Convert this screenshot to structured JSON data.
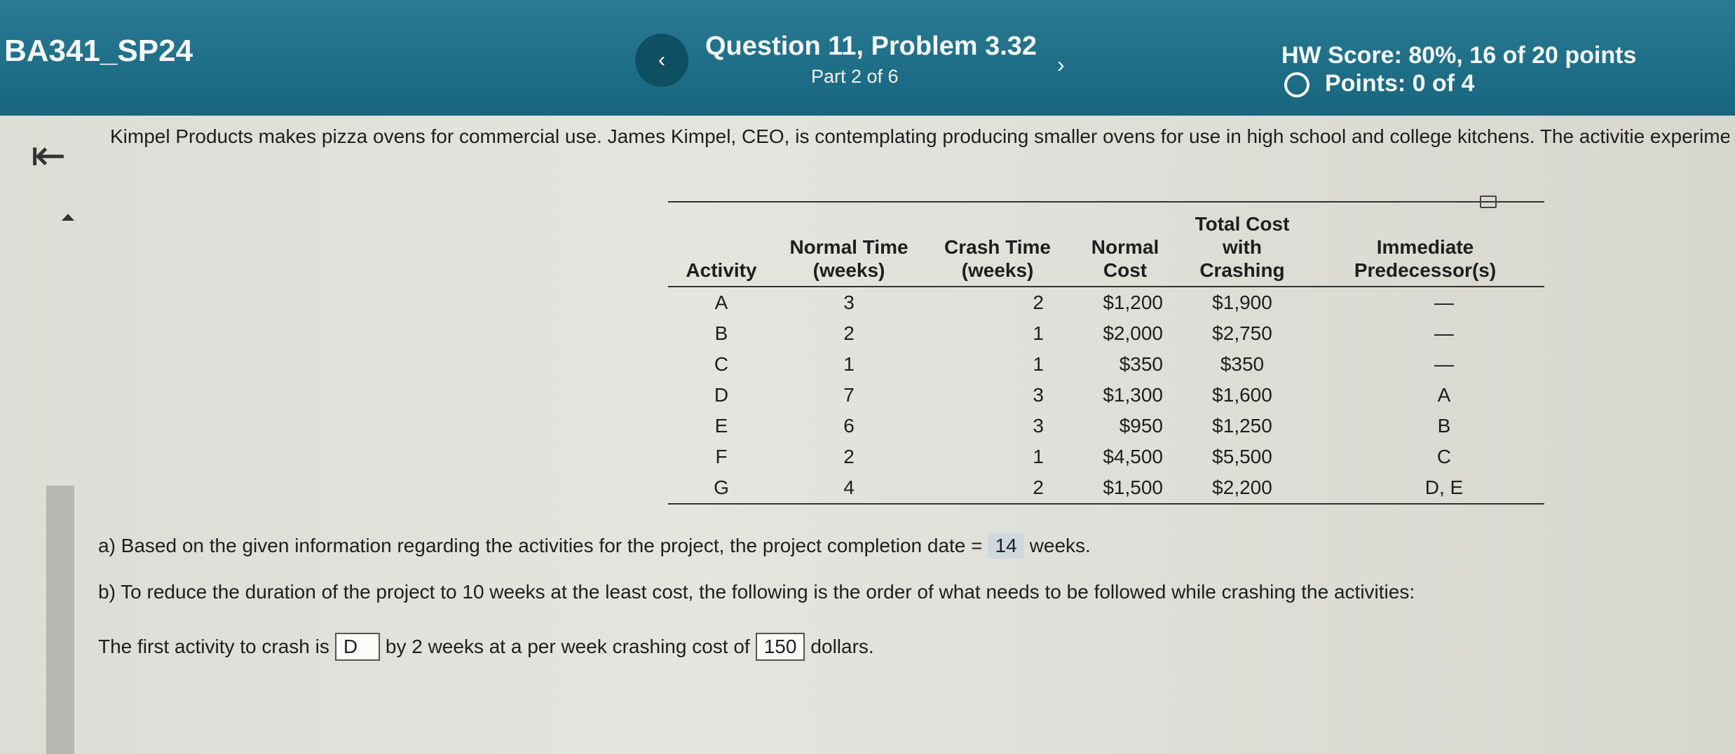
{
  "header": {
    "course": "BA341_SP24",
    "question_title": "Question 11, Problem 3.32",
    "part": "Part 2 of 6",
    "hw_score": "HW Score: 80%, 16 of 20 points",
    "points": "Points: 0 of 4",
    "prev_icon": "‹",
    "next_icon": "›"
  },
  "intro": "Kimpel Products makes pizza ovens for commercial use. James Kimpel, CEO, is contemplating producing smaller ovens for use in high school and college kitchens. The activitie experimental model and related data are listed in the following table:",
  "table": {
    "headers": [
      "Activity",
      "Normal Time (weeks)",
      "Crash Time (weeks)",
      "Normal Cost",
      "Total Cost with Crashing",
      "Immediate Predecessor(s)"
    ],
    "rows": [
      [
        "A",
        "3",
        "2",
        "$1,200",
        "$1,900",
        "—"
      ],
      [
        "B",
        "2",
        "1",
        "$2,000",
        "$2,750",
        "—"
      ],
      [
        "C",
        "1",
        "1",
        "$350",
        "$350",
        "—"
      ],
      [
        "D",
        "7",
        "3",
        "$1,300",
        "$1,600",
        "A"
      ],
      [
        "E",
        "6",
        "3",
        "$950",
        "$1,250",
        "B"
      ],
      [
        "F",
        "2",
        "1",
        "$4,500",
        "$5,500",
        "C"
      ],
      [
        "G",
        "4",
        "2",
        "$1,500",
        "$2,200",
        "D, E"
      ]
    ]
  },
  "qa": {
    "prefix": "a) Based on the given information regarding the activities for the project, the project completion date =",
    "value": "14",
    "suffix": "weeks."
  },
  "qb": {
    "text": "b) To reduce the duration of the project to 10 weeks at the least cost, the following is the order of what needs to be followed while crashing the activities:"
  },
  "first_crash": {
    "prefix": "The first activity to crash is",
    "activity": "D",
    "middle": "by 2 weeks at a per week crashing cost of",
    "cost": "150",
    "suffix": "dollars."
  },
  "colors": {
    "header_bg": "#1f6f88",
    "nav_button": "#0f4f63",
    "content_bg": "#dfe0da"
  }
}
